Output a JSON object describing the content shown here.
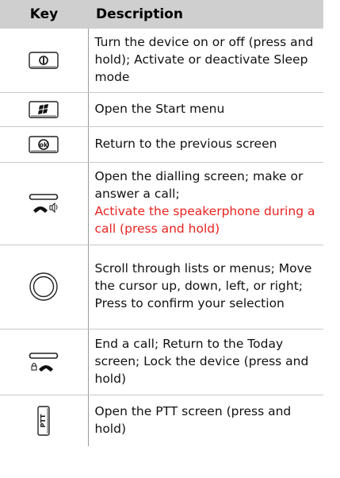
{
  "header": {
    "key": "Key",
    "description": "Description"
  },
  "rows": [
    {
      "icon": "power-key-icon",
      "text": "Turn the device on or off (press and hold); Activate or deactivate Sleep mode"
    },
    {
      "icon": "windows-start-key-icon",
      "text": "Open the Start menu"
    },
    {
      "icon": "ok-key-icon",
      "text": "Return to the previous screen"
    },
    {
      "icon": "dial-speaker-key-icon",
      "text": "Open the dialling screen; make or answer a call;",
      "highlight": "Activate the speakerphone during a call (press and hold)"
    },
    {
      "icon": "navigation-key-icon",
      "text": "Scroll through lists or menus; Move the cursor up, down, left, or right; Press to confirm your selection"
    },
    {
      "icon": "end-lock-key-icon",
      "text": "End a call; Return to the Today screen; Lock the device (press and hold)"
    },
    {
      "icon": "ptt-key-icon",
      "text": "Open the PTT screen (press and hold)",
      "icon_label": "PTT"
    }
  ],
  "colors": {
    "header_bg": "#cfcfcf",
    "highlight": "#e8231f"
  }
}
